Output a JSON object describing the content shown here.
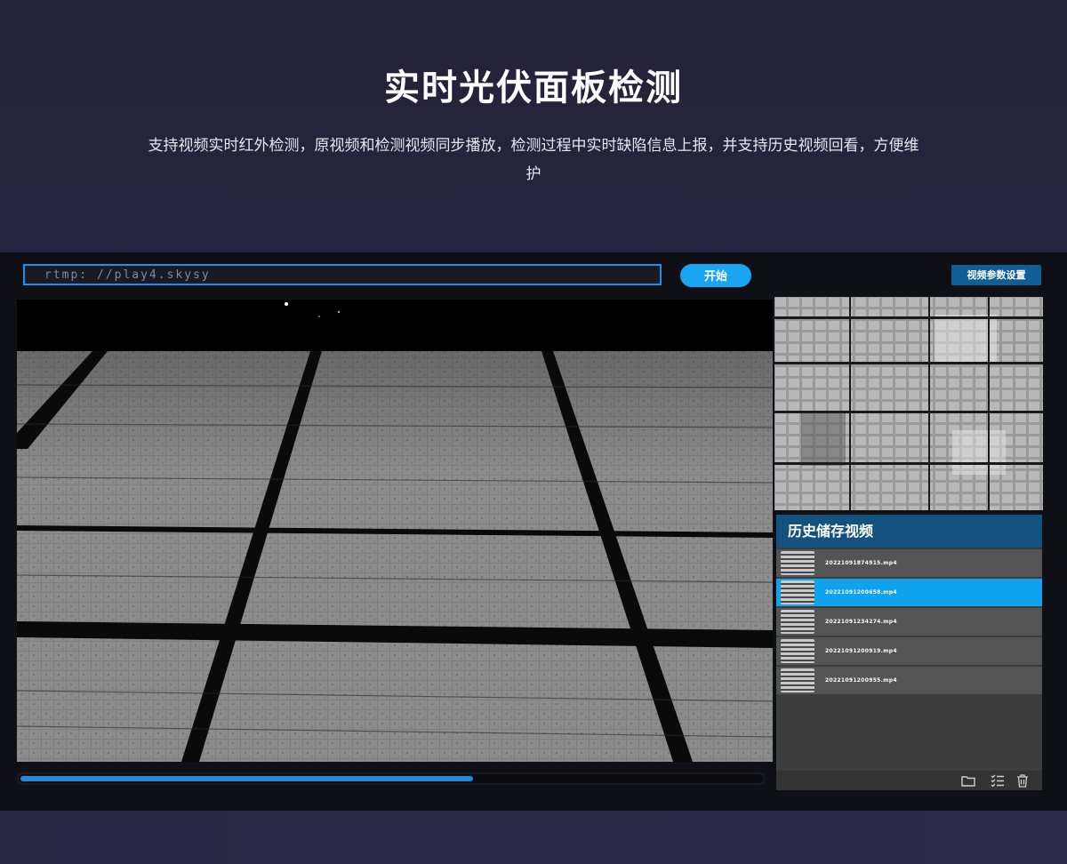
{
  "hero": {
    "title": "实时光伏面板检测",
    "description": "支持视频实时红外检测，原视频和检测视频同步播放，检测过程中实时缺陷信息上报，并支持历史视频回看，方便维护"
  },
  "toolbar": {
    "url_value": "rtmp: //play4.skysy",
    "start_label": "开始",
    "params_label": "视频参数设置"
  },
  "player": {
    "progress": 0.61
  },
  "history": {
    "title": "历史储存视频",
    "items": [
      {
        "name": "20221091874915.mp4",
        "active": false
      },
      {
        "name": "20221091200658.mp4",
        "active": true
      },
      {
        "name": "20221091234274.mp4",
        "active": false
      },
      {
        "name": "20221091200919.mp4",
        "active": false
      },
      {
        "name": "20221091200955.mp4",
        "active": false
      }
    ],
    "footer_icons": [
      "folder-icon",
      "checklist-icon",
      "trash-icon"
    ]
  },
  "colors": {
    "accent": "#19a5f1",
    "header_blue": "#13527e",
    "selected_row": "#10a2ea"
  }
}
